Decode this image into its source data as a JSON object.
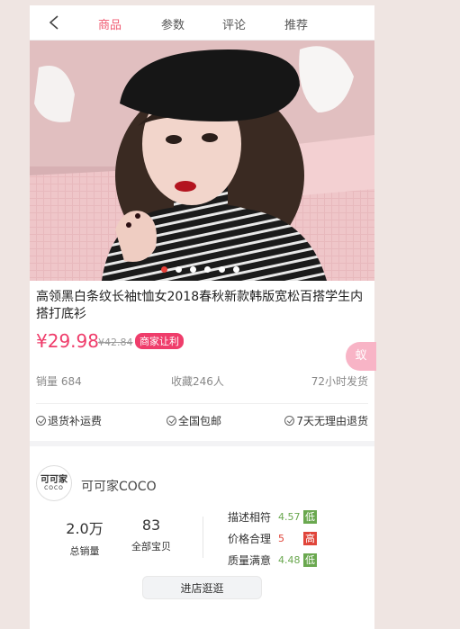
{
  "nav": {
    "tabs": [
      {
        "label": "商品",
        "active": true
      },
      {
        "label": "参数"
      },
      {
        "label": "评论"
      },
      {
        "label": "推荐"
      }
    ]
  },
  "carousel": {
    "total": 6,
    "active_index": 0
  },
  "product": {
    "title": "高领黑白条纹长袖t恤女2018春秋新款韩版宽松百搭学生内搭打底衫",
    "price": "¥29.98",
    "old_price": "¥42.84",
    "badge": "商家让利",
    "sales": "销量 684",
    "favorites": "收藏246人",
    "shipping": "72小时发货",
    "services": [
      "退货补运费",
      "全国包邮",
      "7天无理由退货"
    ]
  },
  "shop": {
    "logo_text": "可可家",
    "logo_sub": "COCO",
    "name": "可可家COCO",
    "total_sales": {
      "value": "2.0万",
      "label": "总销量"
    },
    "all_items": {
      "value": "83",
      "label": "全部宝贝"
    },
    "ratings": [
      {
        "label": "描述相符",
        "score": "4.57",
        "tag": "低",
        "color": "#6aa84f"
      },
      {
        "label": "价格合理",
        "score": "5",
        "tag": "高",
        "color": "#e0453a"
      },
      {
        "label": "质量满意",
        "score": "4.48",
        "tag": "低",
        "color": "#6aa84f"
      }
    ],
    "enter_button": "进店逛逛"
  },
  "float_button": {
    "label": "蚁"
  },
  "colors": {
    "accent": "#ef3d6b",
    "background": "#efe5e2"
  }
}
